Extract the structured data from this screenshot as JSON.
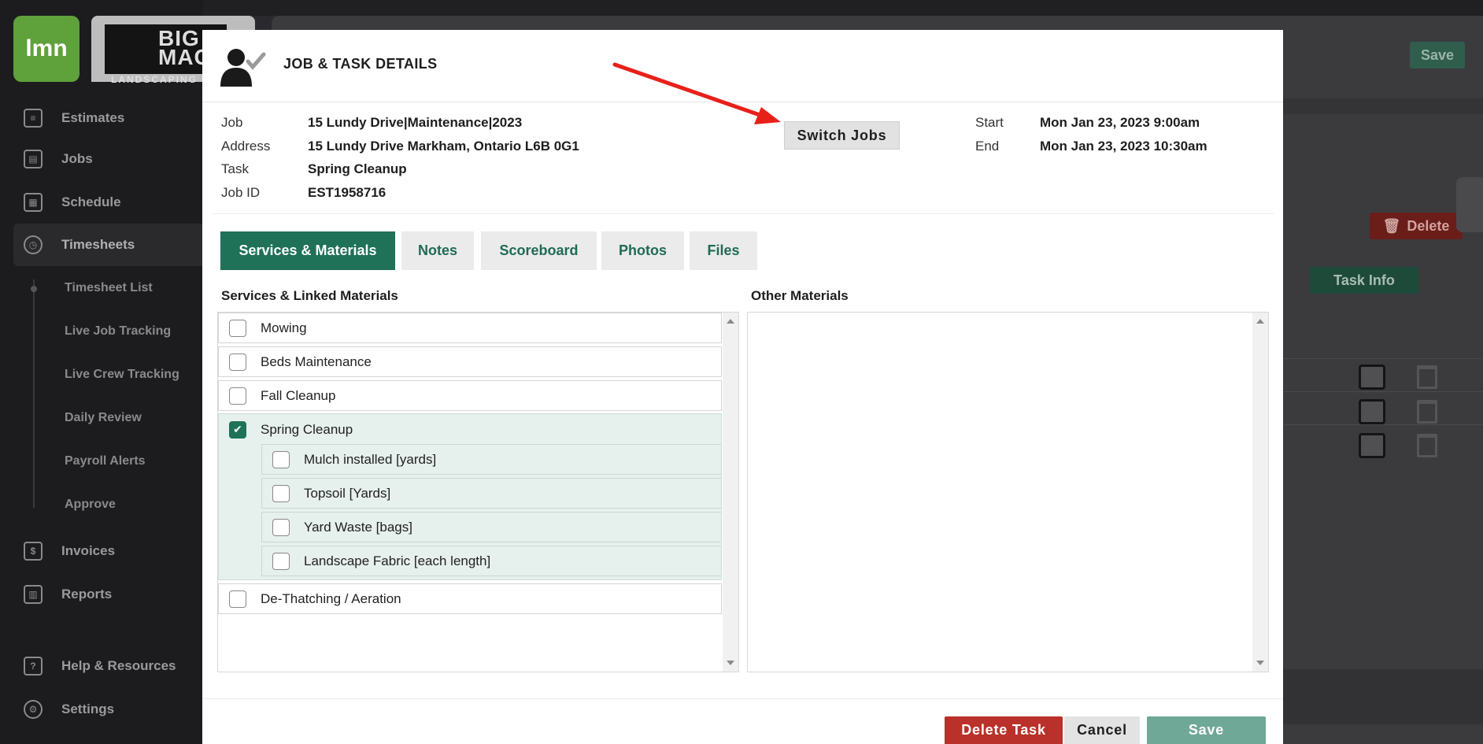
{
  "sidebar": {
    "logo_text": "lmn",
    "brand_name": "BIG MAC",
    "brand_tagline": "LANDSCAPING",
    "items": [
      {
        "label": "Estimates"
      },
      {
        "label": "Jobs"
      },
      {
        "label": "Schedule"
      },
      {
        "label": "Timesheets"
      },
      {
        "label": "Invoices"
      },
      {
        "label": "Reports"
      },
      {
        "label": "Help & Resources"
      },
      {
        "label": "Settings"
      }
    ],
    "timesheet_sub": [
      {
        "label": "Timesheet List"
      },
      {
        "label": "Live Job Tracking"
      },
      {
        "label": "Live Crew Tracking"
      },
      {
        "label": "Daily Review"
      },
      {
        "label": "Payroll Alerts"
      },
      {
        "label": "Approve"
      }
    ]
  },
  "background": {
    "save_label": "Save",
    "delete_label": "Delete",
    "task_info_label": "Task Info"
  },
  "modal": {
    "title": "JOB & TASK DETAILS",
    "info": {
      "job_label": "Job",
      "job_value": "15 Lundy Drive|Maintenance|2023",
      "address_label": "Address",
      "address_value": "15 Lundy Drive Markham, Ontario L6B 0G1",
      "task_label": "Task",
      "task_value": "Spring Cleanup",
      "jobid_label": "Job ID",
      "jobid_value": "EST1958716",
      "start_label": "Start",
      "start_value": "Mon Jan 23, 2023 9:00am",
      "end_label": "End",
      "end_value": "Mon Jan 23, 2023 10:30am"
    },
    "switch_jobs_label": "Switch Jobs",
    "tabs": [
      {
        "label": "Services & Materials",
        "active": true
      },
      {
        "label": "Notes"
      },
      {
        "label": "Scoreboard"
      },
      {
        "label": "Photos"
      },
      {
        "label": "Files"
      }
    ],
    "services_title": "Services & Linked Materials",
    "other_title": "Other Materials",
    "services": [
      {
        "label": "Mowing",
        "checked": false
      },
      {
        "label": "Beds Maintenance",
        "checked": false
      },
      {
        "label": "Fall Cleanup",
        "checked": false
      },
      {
        "label": "Spring Cleanup",
        "checked": true
      },
      {
        "label": "De-Thatching / Aeration",
        "checked": false
      }
    ],
    "spring_materials": [
      {
        "label": "Mulch installed [yards]",
        "checked": false
      },
      {
        "label": "Topsoil [Yards]",
        "checked": false
      },
      {
        "label": "Yard Waste [bags]",
        "checked": false
      },
      {
        "label": "Landscape Fabric [each length]",
        "checked": false
      }
    ],
    "footer": {
      "delete_label": "Delete Task",
      "cancel_label": "Cancel",
      "save_label": "Save"
    }
  },
  "colors": {
    "accent_green": "#1f7158",
    "delete_red": "#b9312a",
    "arrow_red": "#e8201a"
  }
}
